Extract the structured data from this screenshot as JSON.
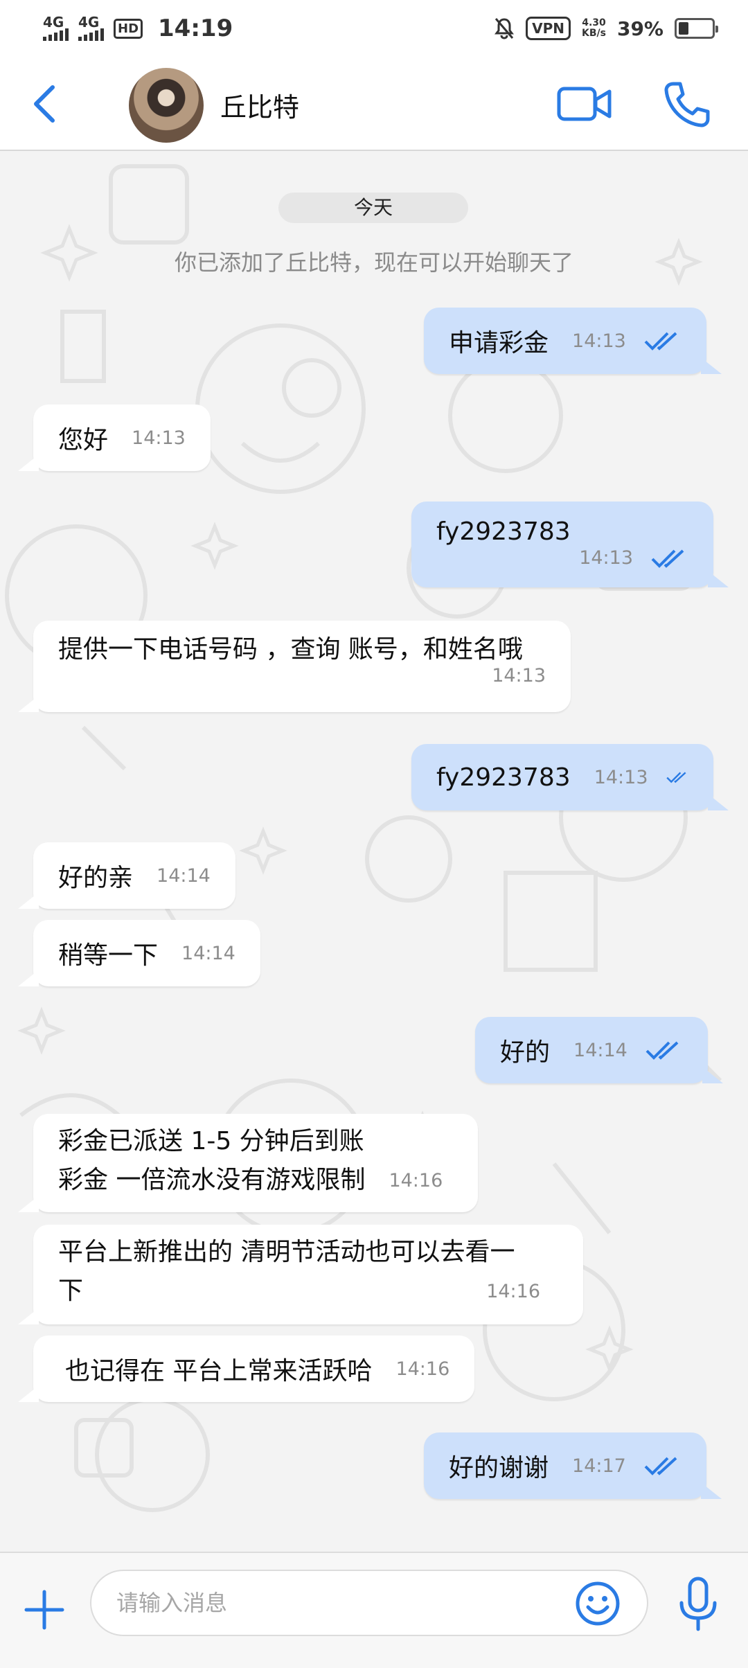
{
  "status_bar": {
    "network_1": "4G",
    "network_2": "4G",
    "hd": "HD",
    "time": "14:19",
    "vpn": "VPN",
    "speed_value": "4.30",
    "speed_unit": "KB/s",
    "battery": "39%"
  },
  "header": {
    "contact_name": "丘比特"
  },
  "chat": {
    "date_label": "今天",
    "system_note": "你已添加了丘比特，现在可以开始聊天了",
    "messages": [
      {
        "dir": "out",
        "text": "申请彩金",
        "time": "14:13"
      },
      {
        "dir": "in",
        "text": "您好",
        "time": "14:13"
      },
      {
        "dir": "out",
        "text": "fy2923783",
        "time": "14:13"
      },
      {
        "dir": "in",
        "text": "提供一下电话号码 ，查询 账号，和姓名哦",
        "time": "14:13"
      },
      {
        "dir": "out",
        "text": "fy2923783",
        "time": "14:13"
      },
      {
        "dir": "in",
        "text": "好的亲",
        "time": "14:14"
      },
      {
        "dir": "in",
        "text": "稍等一下",
        "time": "14:14"
      },
      {
        "dir": "out",
        "text": "好的",
        "time": "14:14"
      },
      {
        "dir": "in",
        "line1": "彩金已派送 1-5 分钟后到账",
        "line2": "彩金 一倍流水没有游戏限制",
        "time": "14:16"
      },
      {
        "dir": "in",
        "line1": "平台上新推出的 清明节活动也可以去看一",
        "line2": "下",
        "time": "14:16"
      },
      {
        "dir": "in",
        "text": "也记得在 平台上常来活跃哈",
        "time": "14:16"
      },
      {
        "dir": "out",
        "text": "好的谢谢",
        "time": "14:17"
      }
    ]
  },
  "input": {
    "placeholder": "请输入消息"
  },
  "colors": {
    "accent": "#2a7be4",
    "outgoing_bubble": "#cde0fb",
    "incoming_bubble": "#ffffff"
  }
}
